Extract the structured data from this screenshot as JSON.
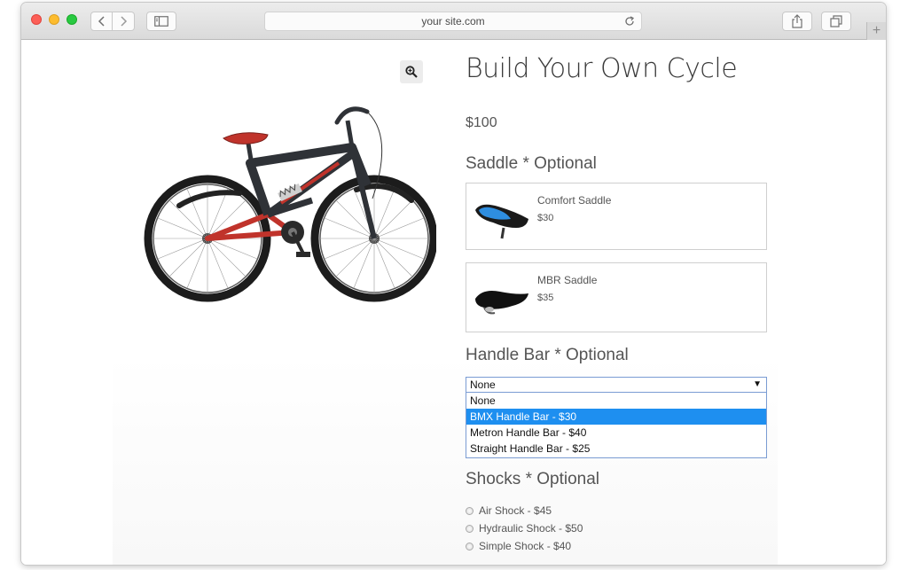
{
  "browser": {
    "url": "your site.com",
    "icons": {
      "back": "chevron-left-icon",
      "forward": "chevron-right-icon",
      "sidebar": "sidebar-icon",
      "reload": "reload-icon",
      "share": "share-icon",
      "tabs": "tabs-icon",
      "new_tab": "plus-icon"
    },
    "new_tab_glyph": "+"
  },
  "product": {
    "title": "Build Your Own Cycle",
    "price": "$100",
    "image_icon": "bicycle-image",
    "zoom_icon": "magnify-icon"
  },
  "saddle": {
    "label": "Saddle * Optional",
    "items": [
      {
        "name": "Comfort Saddle",
        "price": "$30",
        "image": "comfort-saddle-image"
      },
      {
        "name": "MBR Saddle",
        "price": "$35",
        "image": "mbr-saddle-image"
      }
    ]
  },
  "handle_bar": {
    "label": "Handle Bar * Optional",
    "selected_value": "None",
    "arrow": "▼",
    "options": [
      "None",
      "BMX Handle Bar - $30",
      "Metron Handle Bar - $40",
      "Straight Handle Bar - $25"
    ],
    "highlighted_option": "BMX Handle Bar - $30"
  },
  "shocks": {
    "label": "Shocks * Optional",
    "options": [
      "Air Shock - $45",
      "Hydraulic Shock - $50",
      "Simple Shock - $40"
    ]
  },
  "colors": {
    "accent_highlight": "#1e8ff0",
    "select_border": "#7a9cd3",
    "bike_frame": "#2f3237",
    "bike_accent": "#c0332b",
    "saddle_blue": "#2e8ee0"
  }
}
